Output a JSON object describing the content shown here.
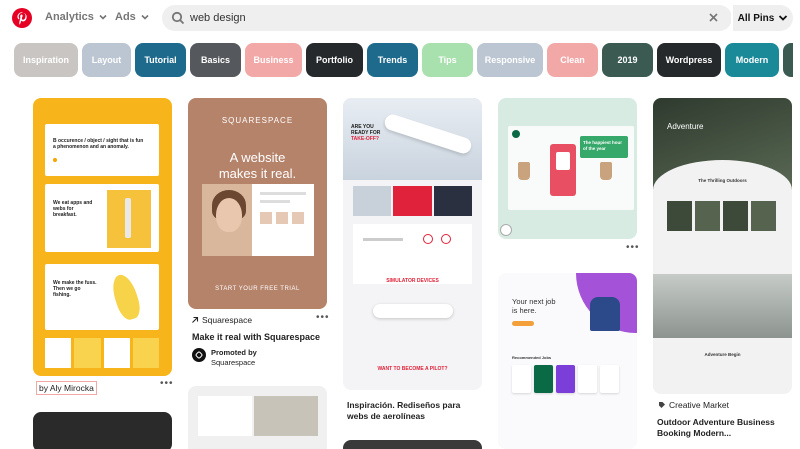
{
  "topbar": {
    "logo_icon": "pinterest-logo-icon",
    "nav": [
      "Analytics",
      "Ads"
    ],
    "search": {
      "value": "web design",
      "placeholder": ""
    },
    "scope": "All Pins"
  },
  "chips": [
    {
      "label": "Inspiration",
      "color": "#c9c5c2"
    },
    {
      "label": "Layout",
      "color": "#bcc6d3"
    },
    {
      "label": "Tutorial",
      "color": "#1d6a8d"
    },
    {
      "label": "Basics",
      "color": "#55585c"
    },
    {
      "label": "Business",
      "color": "#f3a8a8"
    },
    {
      "label": "Portfolio",
      "color": "#25292c"
    },
    {
      "label": "Trends",
      "color": "#1d6a8d"
    },
    {
      "label": "Tips",
      "color": "#a8e0ae"
    },
    {
      "label": "Responsive",
      "color": "#bcc6d3"
    },
    {
      "label": "Clean",
      "color": "#f3a8a8"
    },
    {
      "label": "2019",
      "color": "#3a5a52"
    },
    {
      "label": "Wordpress",
      "color": "#25292c"
    },
    {
      "label": "Modern",
      "color": "#1a8a99"
    }
  ],
  "pins": {
    "p1": {
      "lines": [
        "B occurence / object / sight that is fun",
        "a phenomenon and an anomaly.",
        "We eat apps and webs for breakfast.",
        "We make the fuss. Then we go fishing."
      ],
      "author": "by Aly Mirocka"
    },
    "p2": {
      "brand": "SQUARESPACE",
      "headline_1": "A website",
      "headline_2": "makes it real.",
      "cta": "START YOUR FREE TRIAL",
      "domain": "Squarespace",
      "title": "Make it real with Squarespace",
      "promoted_label": "Promoted by",
      "promoted_by": "Squarespace"
    },
    "p3": {
      "hero_1": "ARE YOU",
      "hero_2": "READY FOR",
      "hero_3": "TAKE-OFF?",
      "section": "SIMULATOR DEVICES",
      "cta": "WANT TO BECOME A PILOT?",
      "title_1": "Inspiración. Rediseños para",
      "title_2": "webs de aerolíneas"
    },
    "p4": {
      "heading_1": "The happiest hour",
      "heading_2": "of the year"
    },
    "p5": {
      "headline_1": "Your next job",
      "headline_2": "is here.",
      "section": "Recommended Jobs"
    },
    "p6": {
      "hero_title": "Adventure",
      "subtitle": "The Thrilling Outdoors",
      "section": "Adventure Begin",
      "source": "Creative Market",
      "title_1": "Outdoor Adventure Business",
      "title_2": "Booking Modern..."
    }
  },
  "more_label": "•••"
}
